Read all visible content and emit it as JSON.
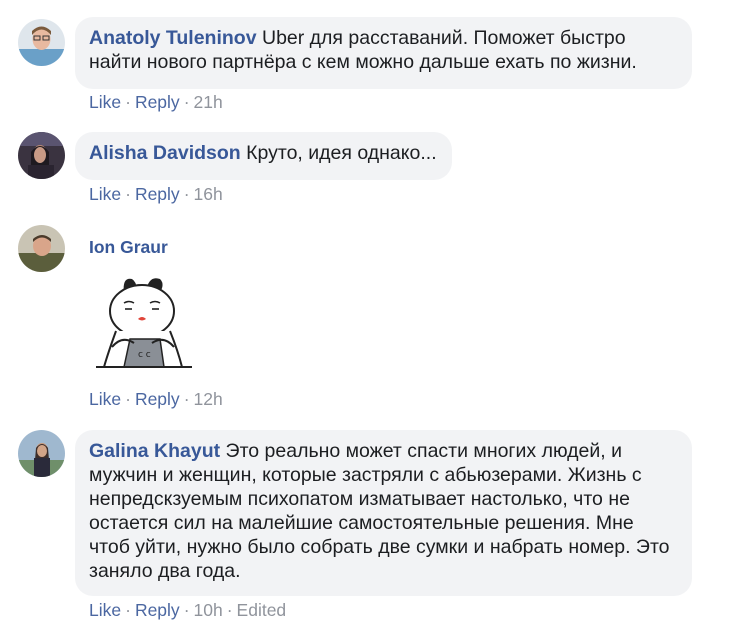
{
  "comments": [
    {
      "author": "Anatoly Tuleninov",
      "text": "Uber для расставаний. Поможет быстро найти нового партнёра с кем можно дальше ехать по жизни.",
      "like_label": "Like",
      "reply_label": "Reply",
      "time": "21h"
    },
    {
      "author": "Alisha Davidson",
      "text": "Круто, идея однако...",
      "like_label": "Like",
      "reply_label": "Reply",
      "time": "16h"
    },
    {
      "author": "Ion Graur",
      "sticker": "sad-cat-at-laptop-sticker",
      "like_label": "Like",
      "reply_label": "Reply",
      "time": "12h"
    },
    {
      "author": "Galina Khayut",
      "text": "Это реально может спасти многих людей, и мужчин и женщин, которые застряли с абьюзерами. Жизнь с непредскзуемым психопатом изматывает настолько, что не остается сил на малейшие самостоятельные решения. Мне чтоб уйти, нужно было собрать две сумки и набрать номер. Это заняло два года.",
      "like_label": "Like",
      "reply_label": "Reply",
      "time": "10h",
      "edited_label": "Edited"
    }
  ],
  "colors": {
    "author": "#385898",
    "link": "#4b67a1",
    "meta": "#90949c",
    "bubble": "#f2f3f5",
    "text": "#1c1e21"
  }
}
